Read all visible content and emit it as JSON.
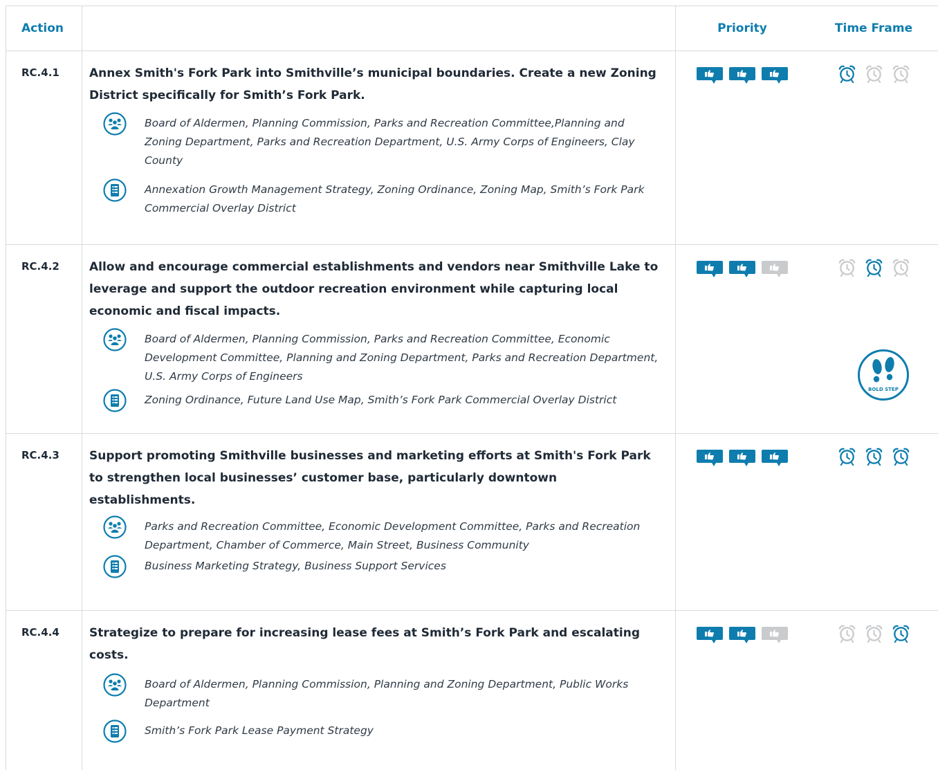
{
  "header": {
    "action_label": "Action",
    "priority_label": "Priority",
    "timeframe_label": "Time Frame"
  },
  "colors": {
    "accent": "#0e7dae",
    "inactive": "#c9cbcd",
    "border": "#d8dadc"
  },
  "icons": {
    "partners": "people-group-icon",
    "resources": "document-list-icon",
    "priority": "thumbs-up-speech-icon",
    "timeframe": "alarm-clock-icon",
    "badge": "footprints-badge-icon"
  },
  "rows": [
    {
      "code": "RC.4.1",
      "title": "Annex Smith's Fork Park into Smithville’s municipal boundaries.  Create a new Zoning District specifically for Smith’s Fork Park.",
      "partners": "Board of Aldermen, Planning Commission, Parks and Recreation Committee,Planning and Zoning Department, Parks and Recreation Department, U.S. Army Corps of Engineers, Clay County",
      "resources": "Annexation Growth Management Strategy, Zoning Ordinance, Zoning Map, Smith’s Fork Park Commercial Overlay District",
      "priority": 3,
      "timeframe_active": [
        true,
        false,
        false
      ]
    },
    {
      "code": "RC.4.2",
      "title": "Allow and encourage commercial establishments and vendors near Smithville Lake to leverage and support the outdoor recreation environment while capturing local economic and fiscal impacts.",
      "partners": "Board of Aldermen, Planning Commission, Parks and Recreation Committee, Economic Development Committee, Planning and Zoning Department, Parks and Recreation Department, U.S. Army Corps of Engineers",
      "resources": "Zoning Ordinance, Future Land Use Map, Smith’s Fork Park Commercial Overlay District",
      "priority": 2,
      "timeframe_active": [
        false,
        true,
        false
      ],
      "badge_label": "BOLD STEP"
    },
    {
      "code": "RC.4.3",
      "title": "Support promoting Smithville businesses and marketing efforts at Smith's Fork Park to strengthen local businesses’ customer base, particularly downtown establishments.",
      "partners": " Parks and Recreation Committee, Economic Development Committee, Parks and Recreation Department, Chamber of Commerce, Main Street, Business Community",
      "resources": " Business Marketing Strategy, Business Support Services",
      "priority": 3,
      "timeframe_active": [
        true,
        true,
        true
      ]
    },
    {
      "code": "RC.4.4",
      "title": "Strategize to prepare for increasing lease fees at Smith’s Fork Park and escalating costs.",
      "partners": "Board of Aldermen, Planning Commission, Planning and Zoning Department, Public Works Department",
      "resources": "Smith’s Fork Park Lease Payment Strategy",
      "priority": 2,
      "timeframe_active": [
        false,
        false,
        true
      ]
    }
  ]
}
